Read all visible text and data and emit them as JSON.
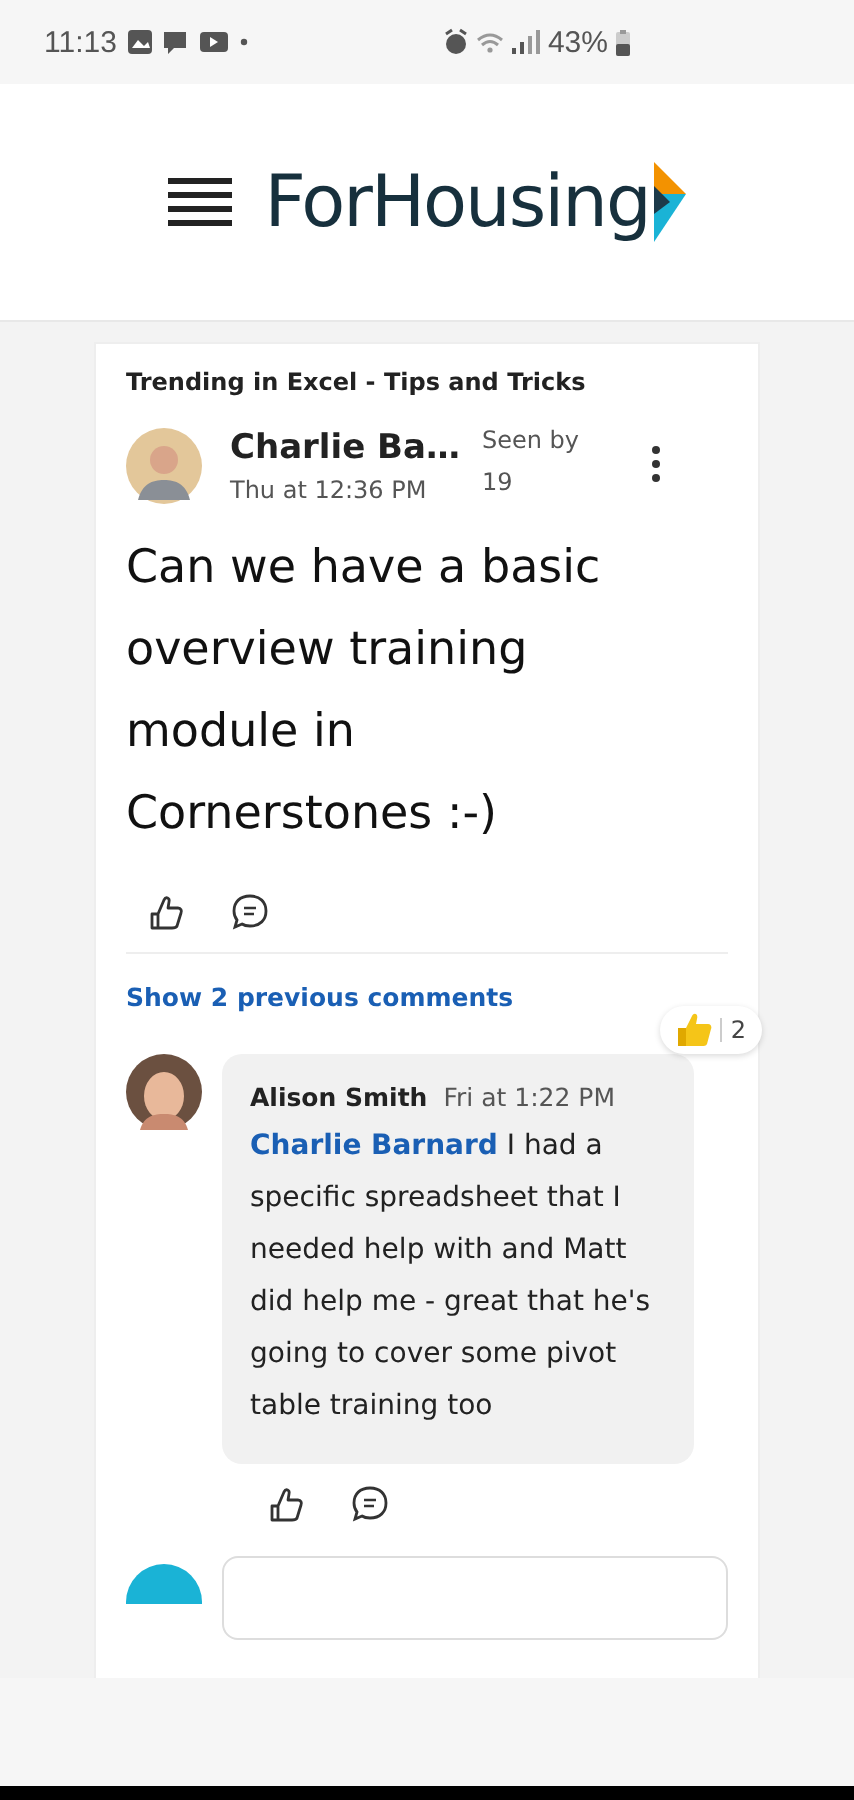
{
  "status_bar": {
    "time": "11:13",
    "battery": "43%"
  },
  "header": {
    "logo": "ForHousing"
  },
  "post": {
    "trending": "Trending in Excel - Tips and Tricks",
    "author": "Charlie Ba…",
    "time": "Thu at 12:36 PM",
    "seen_by": "Seen by 19",
    "body": "Can we have a basic overview training module in Cornerstones :-)",
    "show_previous": "Show 2 previous comments"
  },
  "comments": [
    {
      "author": "Alison Smith",
      "time": "Fri at 1:22 PM",
      "mention": "Charlie Barnard",
      "text": "I had a specific spreadsheet that I needed help with and Matt did help me - great that he's going to cover some pivot table training too",
      "reaction_count": "2"
    }
  ]
}
